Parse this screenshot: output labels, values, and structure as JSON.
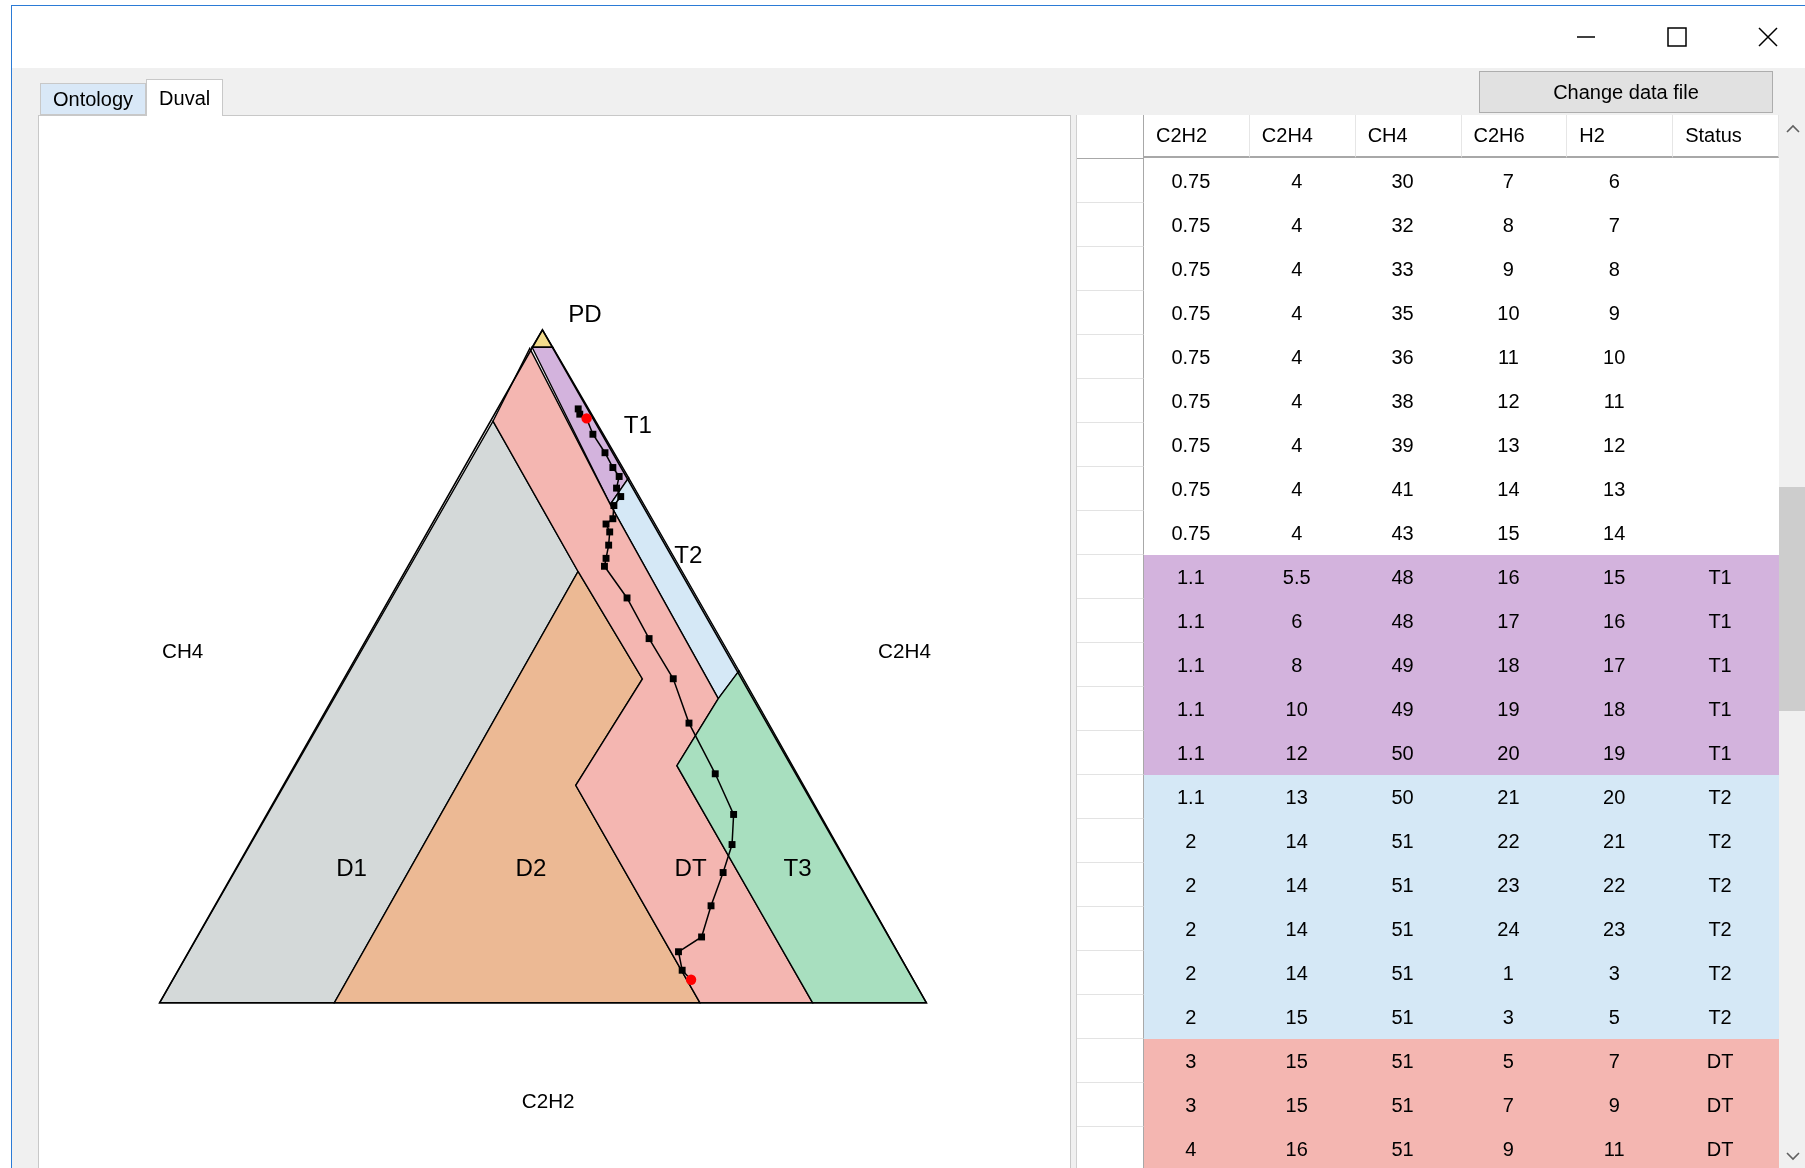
{
  "tabs": [
    {
      "label": "Ontology",
      "selected": false
    },
    {
      "label": "Duval",
      "selected": true
    }
  ],
  "change_button": "Change data file",
  "plot": {
    "regions": [
      {
        "label": "PD",
        "color": "#f2db8c"
      },
      {
        "label": "T1",
        "color": "#d3b3dd"
      },
      {
        "label": "T2",
        "color": "#d5e8f6"
      },
      {
        "label": "D1",
        "color": "#d4d9d9"
      },
      {
        "label": "D2",
        "color": "#ecb994"
      },
      {
        "label": "DT",
        "color": "#f4b6b1"
      },
      {
        "label": "T3",
        "color": "#a8dfbf"
      }
    ],
    "axis_labels": [
      "CH4",
      "C2H4",
      "C2H2"
    ]
  },
  "table": {
    "columns": [
      "C2H2",
      "C2H4",
      "CH4",
      "C2H6",
      "H2",
      "Status"
    ],
    "rows": [
      {
        "cells": [
          "0.75",
          "4",
          "30",
          "7",
          "6"
        ]
      },
      {
        "cells": [
          "0.75",
          "4",
          "32",
          "8",
          "7"
        ]
      },
      {
        "cells": [
          "0.75",
          "4",
          "33",
          "9",
          "8"
        ]
      },
      {
        "cells": [
          "0.75",
          "4",
          "35",
          "10",
          "9"
        ]
      },
      {
        "cells": [
          "0.75",
          "4",
          "36",
          "11",
          "10"
        ]
      },
      {
        "cells": [
          "0.75",
          "4",
          "38",
          "12",
          "11"
        ]
      },
      {
        "cells": [
          "0.75",
          "4",
          "39",
          "13",
          "12"
        ]
      },
      {
        "cells": [
          "0.75",
          "4",
          "41",
          "14",
          "13"
        ]
      },
      {
        "cells": [
          "0.75",
          "4",
          "43",
          "15",
          "14"
        ]
      },
      {
        "cells": [
          "1.1",
          "5.5",
          "48",
          "16",
          "15"
        ],
        "status": "T1",
        "color": "#d3b3dd"
      },
      {
        "cells": [
          "1.1",
          "6",
          "48",
          "17",
          "16"
        ],
        "status": "T1",
        "color": "#d3b3dd"
      },
      {
        "cells": [
          "1.1",
          "8",
          "49",
          "18",
          "17"
        ],
        "status": "T1",
        "color": "#d3b3dd"
      },
      {
        "cells": [
          "1.1",
          "10",
          "49",
          "19",
          "18"
        ],
        "status": "T1",
        "color": "#d3b3dd"
      },
      {
        "cells": [
          "1.1",
          "12",
          "50",
          "20",
          "19"
        ],
        "status": "T1",
        "color": "#d3b3dd"
      },
      {
        "cells": [
          "1.1",
          "13",
          "50",
          "21",
          "20"
        ],
        "status": "T2",
        "color": "#d5e8f6"
      },
      {
        "cells": [
          "2",
          "14",
          "51",
          "22",
          "21"
        ],
        "status": "T2",
        "color": "#d5e8f6"
      },
      {
        "cells": [
          "2",
          "14",
          "51",
          "23",
          "22"
        ],
        "status": "T2",
        "color": "#d5e8f6"
      },
      {
        "cells": [
          "2",
          "14",
          "51",
          "24",
          "23"
        ],
        "status": "T2",
        "color": "#d5e8f6"
      },
      {
        "cells": [
          "2",
          "14",
          "51",
          "1",
          "3"
        ],
        "status": "T2",
        "color": "#d5e8f6"
      },
      {
        "cells": [
          "2",
          "15",
          "51",
          "3",
          "5"
        ],
        "status": "T2",
        "color": "#d5e8f6"
      },
      {
        "cells": [
          "3",
          "15",
          "51",
          "5",
          "7"
        ],
        "status": "DT",
        "color": "#f4b6b1"
      },
      {
        "cells": [
          "3",
          "15",
          "51",
          "7",
          "9"
        ],
        "status": "DT",
        "color": "#f4b6b1"
      },
      {
        "cells": [
          "4",
          "16",
          "51",
          "9",
          "11"
        ],
        "status": "DT",
        "color": "#f4b6b1"
      }
    ]
  }
}
